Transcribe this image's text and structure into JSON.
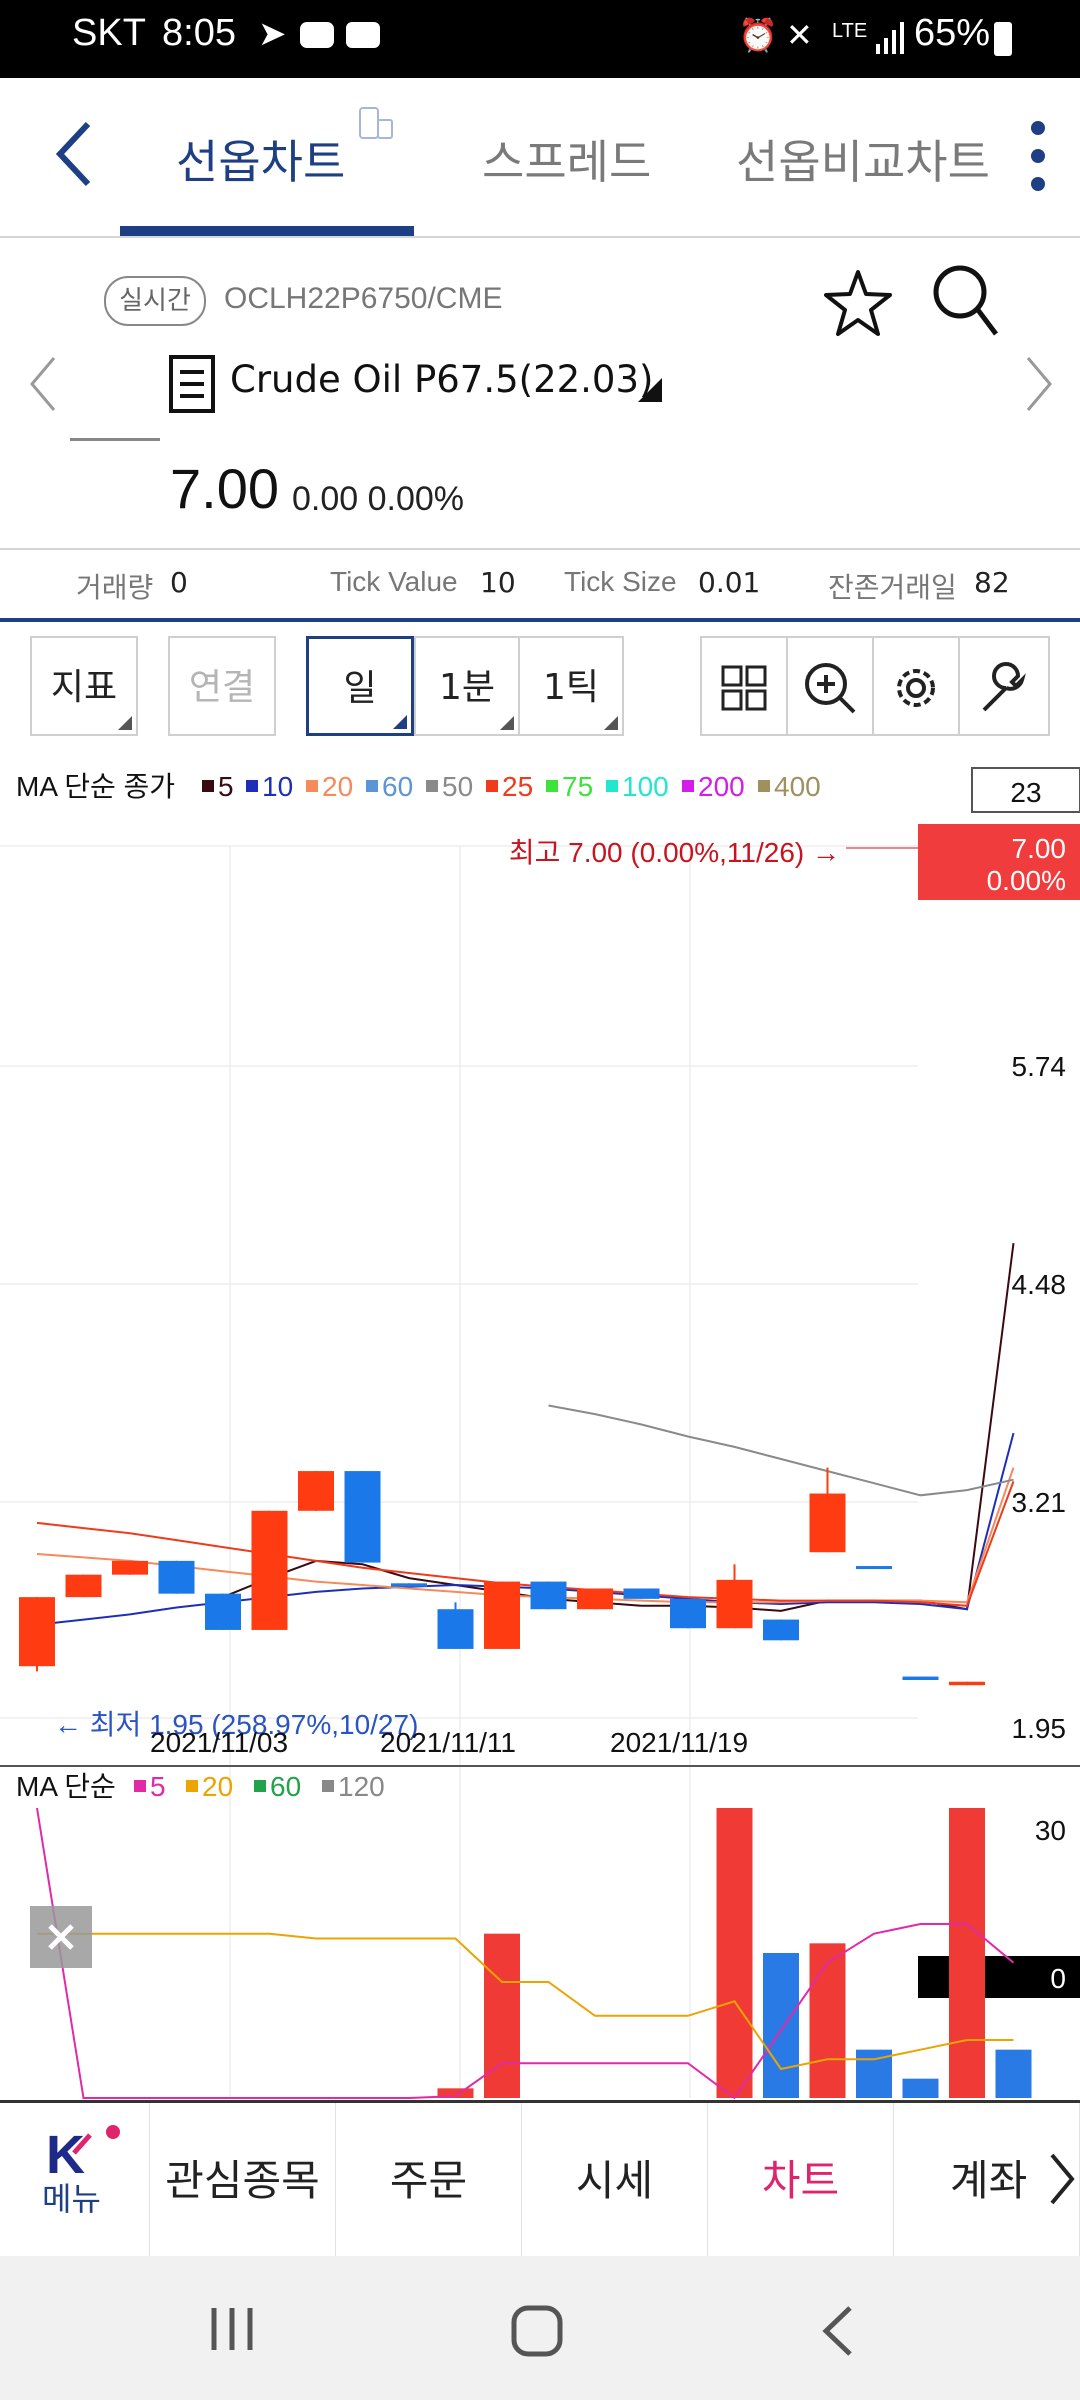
{
  "status_bar": {
    "carrier": "SKT",
    "time": "8:05",
    "network": "LTE",
    "battery": "65%"
  },
  "nav": {
    "tabs": [
      {
        "label": "선옵차트"
      },
      {
        "label": "스프레드"
      },
      {
        "label": "선옵비교차트"
      }
    ]
  },
  "instrument": {
    "badge": "실시간",
    "code": "OCLH22P6750/CME",
    "name": "Crude Oil P67.5(22.03)",
    "price": "7.00",
    "change": "0.00 0.00%"
  },
  "stats": {
    "volume_label": "거래량",
    "volume_value": "0",
    "tick_value_label": "Tick Value",
    "tick_value": "10",
    "tick_size_label": "Tick Size",
    "tick_size": "0.01",
    "remaining_days_label": "잔존거래일",
    "remaining_days": "82"
  },
  "toolbar": {
    "indicator": "지표",
    "link": "연결",
    "day": "일",
    "min": "1분",
    "tick": "1틱"
  },
  "main_chart_legend": {
    "title": "MA 단순 종가",
    "items": [
      {
        "label": "5",
        "color": "#3a0a12"
      },
      {
        "label": "10",
        "color": "#1d2fb8"
      },
      {
        "label": "20",
        "color": "#f58a5a"
      },
      {
        "label": "60",
        "color": "#5b95d8"
      },
      {
        "label": "50",
        "color": "#8a8a8a"
      },
      {
        "label": "25",
        "color": "#f03a1c"
      },
      {
        "label": "75",
        "color": "#3ee23a"
      },
      {
        "label": "100",
        "color": "#22e6cf"
      },
      {
        "label": "200",
        "color": "#d41ee8"
      },
      {
        "label": "400",
        "color": "#a09060"
      }
    ],
    "count": "23"
  },
  "volume_chart_legend": {
    "title": "MA 단순",
    "items": [
      {
        "label": "5",
        "color": "#e02aa8"
      },
      {
        "label": "20",
        "color": "#eba400"
      },
      {
        "label": "60",
        "color": "#22a24a"
      },
      {
        "label": "120",
        "color": "#888888"
      }
    ]
  },
  "chart_data": [
    {
      "type": "candlestick",
      "y_ticks": [
        "5.74",
        "4.48",
        "3.21",
        "1.95"
      ],
      "ylim": [
        1.95,
        7.0
      ],
      "x_labels": [
        "2021/11/03",
        "2021/11/11",
        "2021/11/19"
      ],
      "high_annotation": "최고 7.00 (0.00%,11/26) →",
      "low_annotation": "← 최저 1.95 (258.97%,10/27)",
      "current_price": "7.00",
      "current_change": "0.00%",
      "candles": [
        {
          "open": 2.25,
          "close": 2.65,
          "high": 2.65,
          "low": 2.22
        },
        {
          "open": 2.65,
          "close": 2.78,
          "high": 2.78,
          "low": 2.65
        },
        {
          "open": 2.78,
          "close": 2.86,
          "high": 2.86,
          "low": 2.78
        },
        {
          "open": 2.86,
          "close": 2.67,
          "high": 2.86,
          "low": 2.67
        },
        {
          "open": 2.67,
          "close": 2.46,
          "high": 2.67,
          "low": 2.46
        },
        {
          "open": 2.46,
          "close": 3.15,
          "high": 3.15,
          "low": 2.46
        },
        {
          "open": 3.15,
          "close": 3.38,
          "high": 3.38,
          "low": 3.15
        },
        {
          "open": 3.38,
          "close": 2.85,
          "high": 3.38,
          "low": 2.85
        },
        {
          "open": 2.73,
          "close": 2.71,
          "high": 2.73,
          "low": 2.71
        },
        {
          "open": 2.58,
          "close": 2.35,
          "high": 2.62,
          "low": 2.35
        },
        {
          "open": 2.35,
          "close": 2.74,
          "high": 2.74,
          "low": 2.35
        },
        {
          "open": 2.74,
          "close": 2.58,
          "high": 2.74,
          "low": 2.58
        },
        {
          "open": 2.58,
          "close": 2.7,
          "high": 2.7,
          "low": 2.58
        },
        {
          "open": 2.7,
          "close": 2.64,
          "high": 2.7,
          "low": 2.64
        },
        {
          "open": 2.64,
          "close": 2.47,
          "high": 2.64,
          "low": 2.47
        },
        {
          "open": 2.47,
          "close": 2.75,
          "high": 2.84,
          "low": 2.47
        },
        {
          "open": 2.52,
          "close": 2.4,
          "high": 2.52,
          "low": 2.4
        },
        {
          "open": 2.91,
          "close": 3.25,
          "high": 3.4,
          "low": 2.91
        },
        {
          "open": 2.83,
          "close": 2.82,
          "high": 2.83,
          "low": 2.82
        },
        {
          "open": 2.19,
          "close": 2.17,
          "high": 2.19,
          "low": 2.17
        },
        {
          "open": 2.14,
          "close": 2.16,
          "high": 2.16,
          "low": 2.14
        }
      ],
      "ma_series": [
        {
          "color": "#3a0a12",
          "values": [
            null,
            null,
            null,
            null,
            2.65,
            2.76,
            2.86,
            2.84,
            2.76,
            2.72,
            2.68,
            2.64,
            2.62,
            2.6,
            2.6,
            2.59,
            2.57,
            2.63,
            2.63,
            2.63,
            2.58,
            4.7
          ]
        },
        {
          "color": "#1d2fb8",
          "values": [
            2.49,
            2.52,
            2.55,
            2.59,
            2.62,
            2.65,
            2.68,
            2.7,
            2.71,
            2.72,
            2.71,
            2.7,
            2.68,
            2.66,
            2.64,
            2.62,
            2.61,
            2.62,
            2.62,
            2.61,
            2.58,
            3.6
          ]
        },
        {
          "color": "#f58a5a",
          "values": [
            2.9,
            2.88,
            2.86,
            2.83,
            2.8,
            2.77,
            2.74,
            2.72,
            2.7,
            2.68,
            2.66,
            2.65,
            2.64,
            2.63,
            2.62,
            2.62,
            2.62,
            2.63,
            2.63,
            2.63,
            2.62,
            3.4
          ]
        },
        {
          "color": "#f03a1c",
          "values": [
            3.08,
            3.05,
            3.02,
            2.98,
            2.94,
            2.9,
            2.86,
            2.82,
            2.79,
            2.76,
            2.73,
            2.71,
            2.69,
            2.67,
            2.65,
            2.64,
            2.63,
            2.63,
            2.63,
            2.62,
            2.6,
            3.32
          ]
        },
        {
          "color": "#8a8a8a",
          "values": [
            null,
            null,
            null,
            null,
            null,
            null,
            null,
            null,
            null,
            null,
            null,
            3.76,
            3.71,
            3.65,
            3.58,
            3.52,
            3.45,
            3.38,
            3.31,
            3.24,
            3.27,
            3.33
          ]
        }
      ]
    },
    {
      "type": "bar",
      "y_ticks": [
        "30",
        "0"
      ],
      "bars": [
        {
          "color": "#f03a36",
          "value": 0
        },
        {
          "color": "#f03a36",
          "value": 0
        },
        {
          "color": "#f03a36",
          "value": 0
        },
        {
          "color": "#2a7ae6",
          "value": 0
        },
        {
          "color": "#2a7ae6",
          "value": 0
        },
        {
          "color": "#f03a36",
          "value": 0
        },
        {
          "color": "#f03a36",
          "value": 0
        },
        {
          "color": "#2a7ae6",
          "value": 0
        },
        {
          "color": "#2a7ae6",
          "value": 0
        },
        {
          "color": "#f03a36",
          "value": 1
        },
        {
          "color": "#f03a36",
          "value": 17
        },
        {
          "color": "#2a7ae6",
          "value": 0
        },
        {
          "color": "#f03a36",
          "value": 0
        },
        {
          "color": "#f03a36",
          "value": 0
        },
        {
          "color": "#2a7ae6",
          "value": 0
        },
        {
          "color": "#f03a36",
          "value": 30
        },
        {
          "color": "#2a7ae6",
          "value": 15
        },
        {
          "color": "#f03a36",
          "value": 16
        },
        {
          "color": "#2a7ae6",
          "value": 5
        },
        {
          "color": "#2a7ae6",
          "value": 2
        },
        {
          "color": "#f03a36",
          "value": 30
        },
        {
          "color": "#2a7ae6",
          "value": 5
        }
      ],
      "ma_series": [
        {
          "color": "#e02aa8",
          "values": [
            30,
            0,
            0,
            0,
            0,
            0,
            0,
            0,
            0,
            0.2,
            3.6,
            3.6,
            3.6,
            3.6,
            3.6,
            0,
            7,
            14,
            17,
            18,
            18,
            14
          ]
        },
        {
          "color": "#eba400",
          "values": [
            17,
            17,
            17,
            17,
            17,
            17,
            16.5,
            16.5,
            16.5,
            16.5,
            12,
            12,
            8.5,
            8.5,
            8.5,
            10,
            3,
            4,
            4,
            5,
            6,
            6
          ]
        }
      ]
    }
  ],
  "bottom_nav": {
    "menu": "메뉴",
    "items": [
      "관심종목",
      "주문",
      "시세",
      "차트",
      "계좌"
    ]
  }
}
